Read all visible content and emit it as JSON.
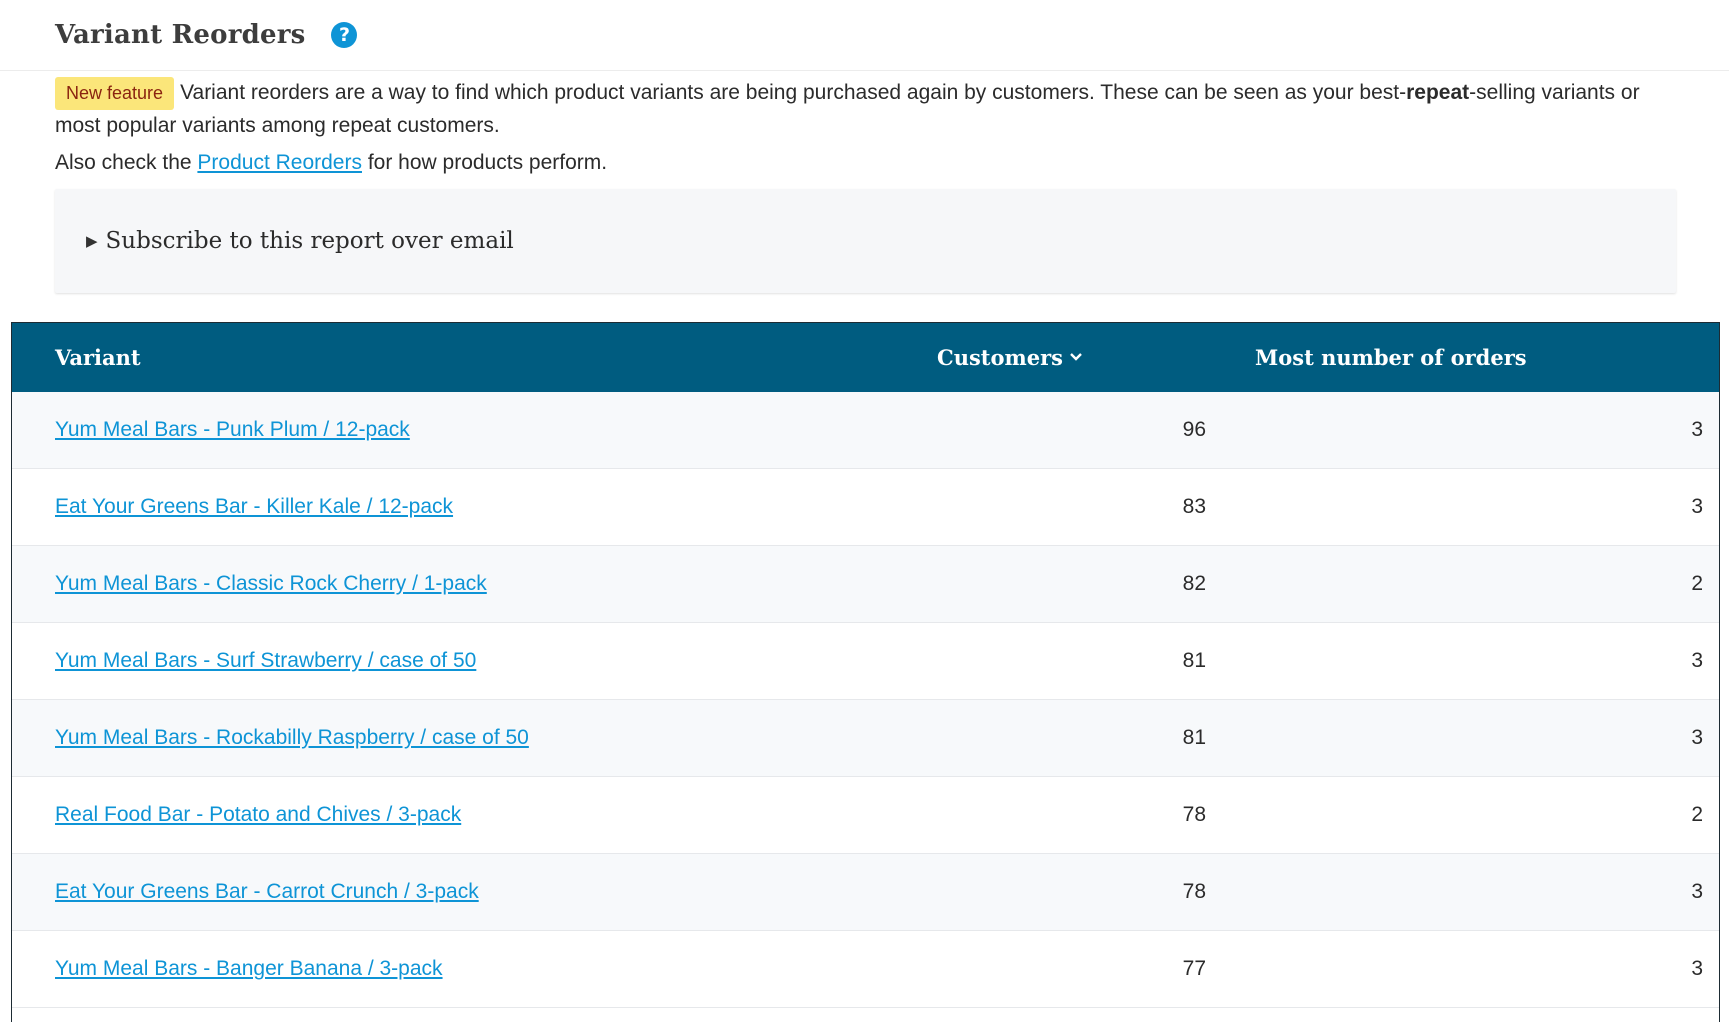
{
  "header": {
    "title": "Variant Reorders",
    "help_icon": "question-circle-icon"
  },
  "intro": {
    "badge": "New feature",
    "text_before_bold": "Variant reorders are a way to find which product variants are being purchased again by customers. These can be seen as your best-",
    "bold_word": "repeat",
    "text_after_bold": "-selling variants or most popular variants among repeat customers.",
    "also_prefix": "Also check the ",
    "also_link": "Product Reorders",
    "also_suffix": " for how products perform."
  },
  "subscribe": {
    "label": "Subscribe to this report over email",
    "icon": "triangle-right-icon"
  },
  "table": {
    "columns": {
      "variant": "Variant",
      "customers": "Customers",
      "orders": "Most number of orders"
    },
    "sort_icon": "chevron-down-icon",
    "rows": [
      {
        "variant": "Yum Meal Bars - Punk Plum / 12-pack",
        "customers": "96",
        "orders": "3"
      },
      {
        "variant": "Eat Your Greens Bar - Killer Kale / 12-pack",
        "customers": "83",
        "orders": "3"
      },
      {
        "variant": "Yum Meal Bars - Classic Rock Cherry / 1-pack",
        "customers": "82",
        "orders": "2"
      },
      {
        "variant": "Yum Meal Bars - Surf Strawberry / case of 50",
        "customers": "81",
        "orders": "3"
      },
      {
        "variant": "Yum Meal Bars - Rockabilly Raspberry / case of 50",
        "customers": "81",
        "orders": "3"
      },
      {
        "variant": "Real Food Bar - Potato and Chives / 3-pack",
        "customers": "78",
        "orders": "2"
      },
      {
        "variant": "Eat Your Greens Bar - Carrot Crunch / 3-pack",
        "customers": "78",
        "orders": "3"
      },
      {
        "variant": "Yum Meal Bars - Banger Banana / 3-pack",
        "customers": "77",
        "orders": "3"
      }
    ]
  },
  "colors": {
    "header_bg": "#005c80",
    "link": "#0e94d6",
    "badge_bg": "#fbe67a",
    "badge_text": "#8a2410"
  }
}
